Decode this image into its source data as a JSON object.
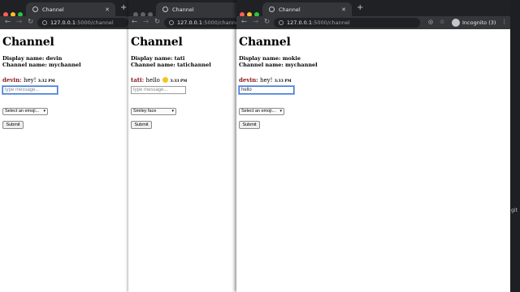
{
  "desktop": {
    "side_label": "git"
  },
  "windows": [
    {
      "tab_title": "Channel",
      "url_host": "127.0.0.1",
      "url_rest": ":5000/channel",
      "page": {
        "heading": "Channel",
        "display_name": "Display name: devin",
        "channel_name": "Channel name: mychannel",
        "message": {
          "user": "devin:",
          "text": "hey!",
          "time": "3:32 PM"
        },
        "input": {
          "value": "",
          "placeholder": "type message..."
        },
        "emoji_select": "Select an emoji...",
        "submit": "Submit"
      }
    },
    {
      "tab_title": "Channel",
      "url_host": "127.0.0.1",
      "url_rest": ":5000/channel",
      "page": {
        "heading": "Channel",
        "display_name": "Display name: tati",
        "channel_name": "Channel name: tatichannel",
        "message": {
          "user": "tati:",
          "text": "hello",
          "emoji": "smiley-face",
          "time": "3:33 PM"
        },
        "input": {
          "value": "",
          "placeholder": "type message..."
        },
        "emoji_select": "Smiley face",
        "submit": "Submit"
      }
    },
    {
      "tab_title": "Channel",
      "url_host": "127.0.0.1",
      "url_rest": ":5000/channel",
      "incognito_label": "Incognito (3)",
      "page": {
        "heading": "Channel",
        "display_name": "Display name: mokie",
        "channel_name": "Channel name: mychannel",
        "message": {
          "user": "devin:",
          "text": "hey!",
          "time": "3:33 PM"
        },
        "input": {
          "value": "hello",
          "placeholder": ""
        },
        "emoji_select": "Select an emoji...",
        "submit": "Submit"
      }
    }
  ],
  "colors": {
    "username": "#8b1a1a",
    "tab_bg": "#35363a",
    "chrome_bg": "#202124"
  }
}
